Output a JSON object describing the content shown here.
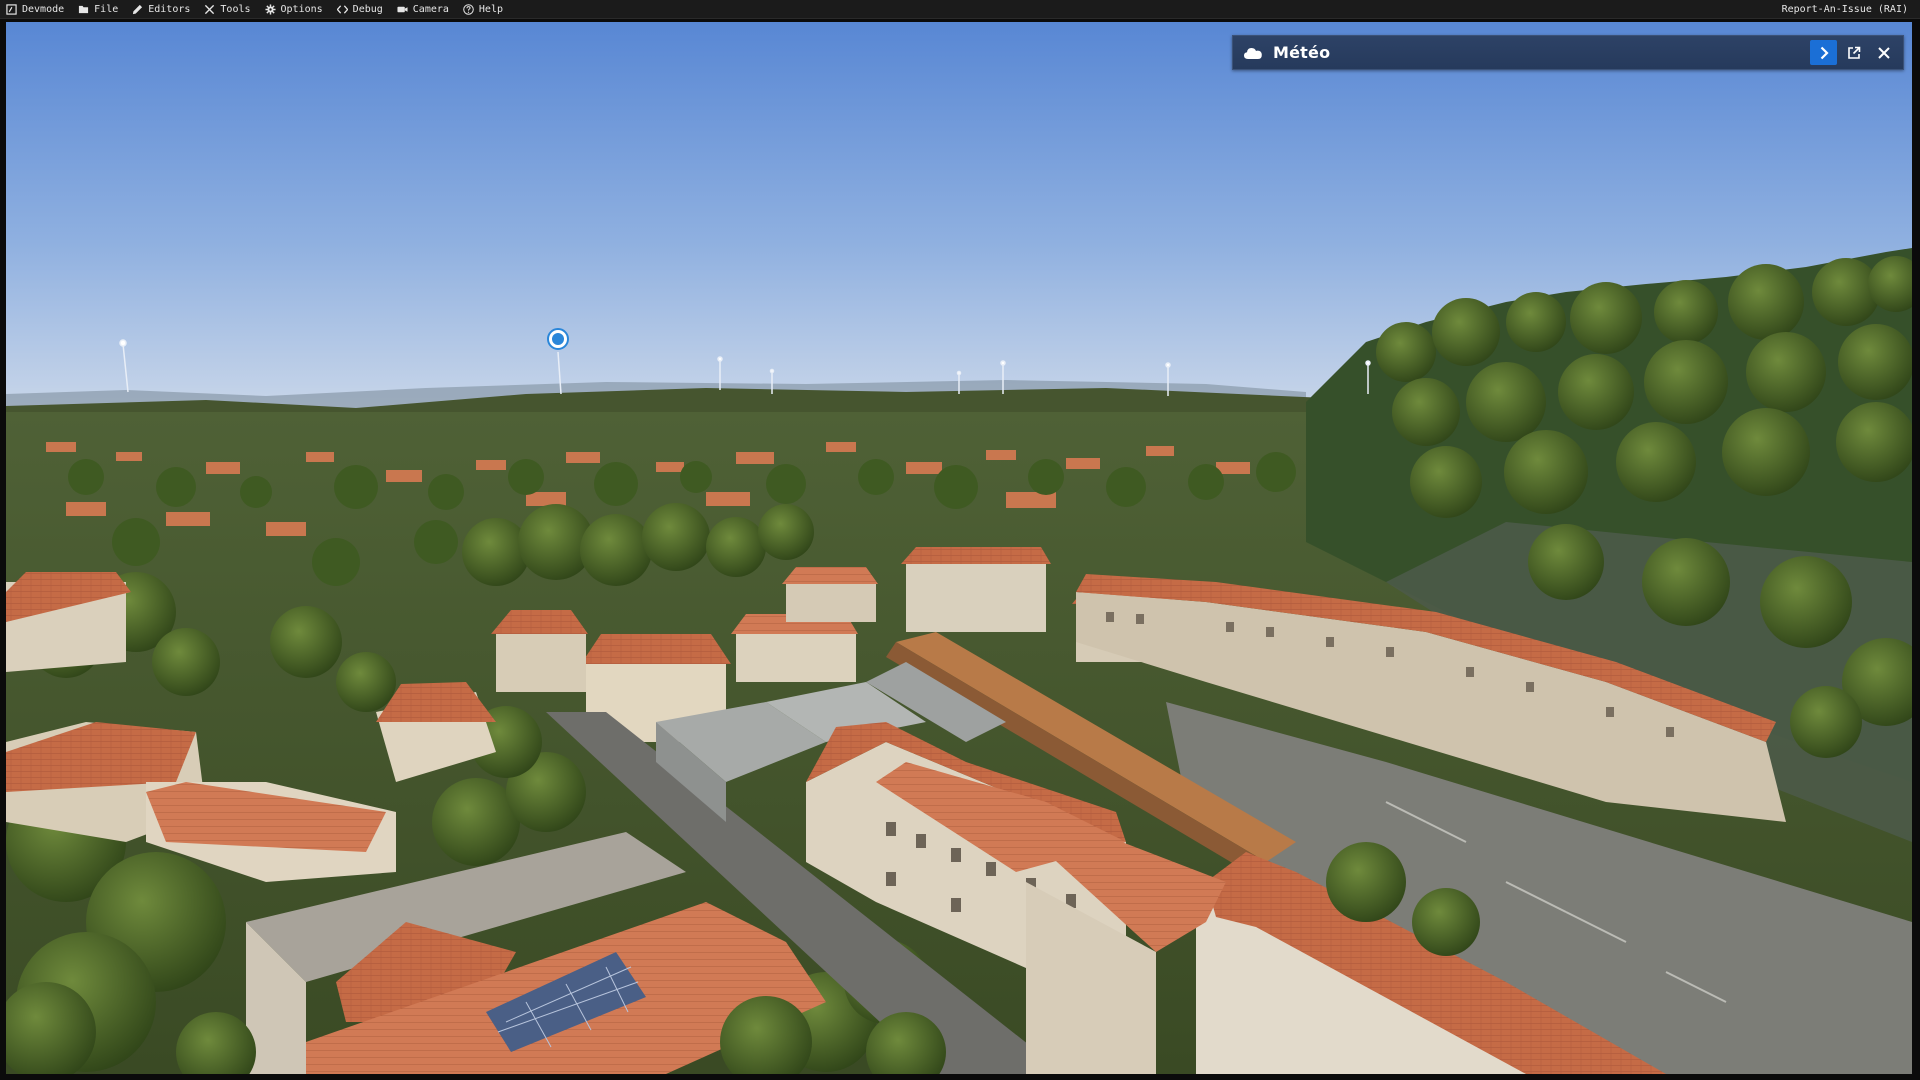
{
  "menubar": {
    "items": [
      {
        "label": "Devmode",
        "icon": "devmode-icon"
      },
      {
        "label": "File",
        "icon": "folder-icon"
      },
      {
        "label": "Editors",
        "icon": "pencil-icon"
      },
      {
        "label": "Tools",
        "icon": "tools-icon"
      },
      {
        "label": "Options",
        "icon": "gear-icon"
      },
      {
        "label": "Debug",
        "icon": "code-icon"
      },
      {
        "label": "Camera",
        "icon": "camera-icon"
      },
      {
        "label": "Help",
        "icon": "help-icon"
      }
    ],
    "report_label": "Report-An-Issue (RAI)"
  },
  "meteo_panel": {
    "title": "Météo",
    "icon": "cloud-icon",
    "actions": [
      {
        "name": "expand-button",
        "icon": "chevron-right-icon"
      },
      {
        "name": "popout-button",
        "icon": "external-window-icon"
      },
      {
        "name": "close-button",
        "icon": "close-icon"
      }
    ],
    "accent_color": "#1b6fd6",
    "header_color": "#2a3f63"
  },
  "viewport": {
    "scene": "aerial view of a town with terracotta roofs, hills and blue sky",
    "colors": {
      "sky_top": "#5b8bd5",
      "sky_horizon": "#c7d6ea",
      "foliage": "#3d5a24",
      "roof": "#c26a45"
    }
  }
}
